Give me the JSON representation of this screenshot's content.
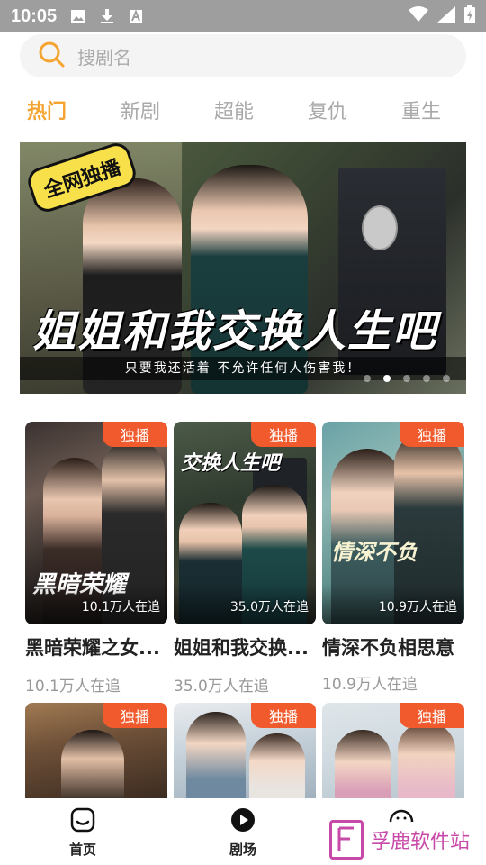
{
  "status_bar": {
    "time": "10:05",
    "icons_left": [
      "image-icon",
      "download-icon",
      "font-icon"
    ],
    "icons_right": [
      "wifi-icon",
      "signal-icon",
      "battery-charging-icon"
    ]
  },
  "search": {
    "placeholder": "搜剧名",
    "icon": "search-icon",
    "accent_color": "#f5a431"
  },
  "tabs": [
    {
      "label": "热门",
      "active": true
    },
    {
      "label": "新剧",
      "active": false
    },
    {
      "label": "超能",
      "active": false
    },
    {
      "label": "复仇",
      "active": false
    },
    {
      "label": "重生",
      "active": false
    }
  ],
  "banner": {
    "badge": "全网独播",
    "title": "姐姐和我交换人生吧",
    "subtitle": "只要我还活着   不允许任何人伤害我！",
    "slide_count": 5,
    "active_slide": 1
  },
  "dramas": [
    {
      "title": "黑暗荣耀之女...",
      "badge": "独播",
      "poster_count": "10.1万人在追",
      "count": "10.1万人在追",
      "poster_text": "黑暗荣耀"
    },
    {
      "title": "姐姐和我交换...",
      "badge": "独播",
      "poster_count": "35.0万人在追",
      "count": "35.0万人在追",
      "poster_text": "交换人生吧"
    },
    {
      "title": "情深不负相思意",
      "badge": "独播",
      "poster_count": "10.9万人在追",
      "count": "10.9万人在追",
      "poster_text": "情深不负"
    },
    {
      "badge": "独播"
    },
    {
      "badge": "独播"
    },
    {
      "badge": "独播"
    }
  ],
  "bottom_nav": [
    {
      "label": "首页",
      "icon": "home-icon"
    },
    {
      "label": "剧场",
      "icon": "play-icon"
    }
  ],
  "watermark": {
    "text": "孚鹿软件站"
  },
  "colors": {
    "accent": "#f5a431",
    "badge": "#f05a2c",
    "watermark": "#c84aa8"
  }
}
